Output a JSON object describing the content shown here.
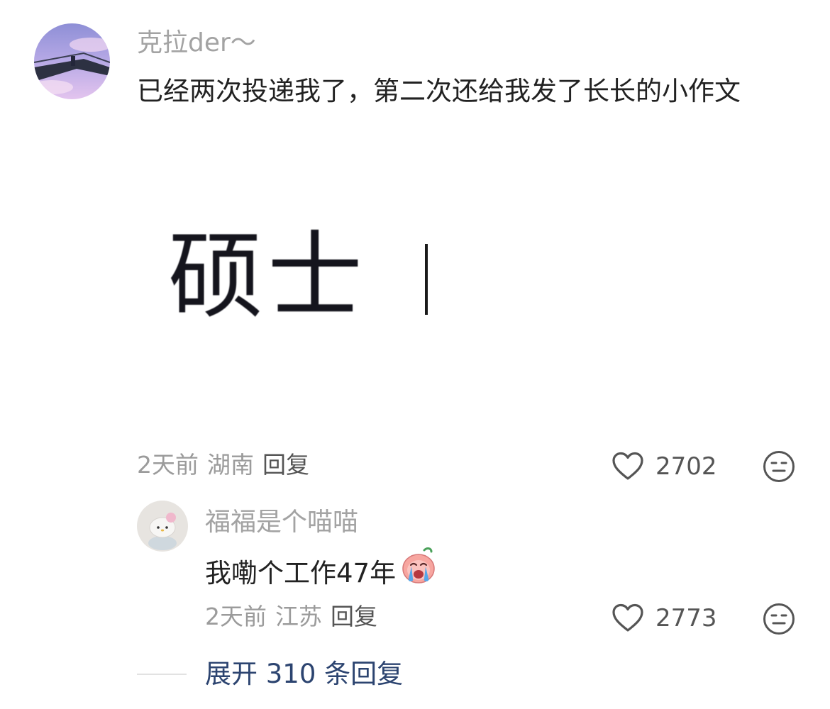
{
  "comment": {
    "username": "克拉der～",
    "text": "已经两次投递我了，第二次还给我发了长长的小作文",
    "image_text": "硕士",
    "meta": {
      "time": "2天前",
      "location": "湖南",
      "reply_label": "回复"
    },
    "likes": "2702",
    "icons": {
      "avatar": "avatar-bridge-photo",
      "like": "heart-outline-icon",
      "dislike": "unamused-face-icon"
    }
  },
  "reply": {
    "username": "福福是个喵喵",
    "text": "我嘞个工作47年",
    "emoji": "crying-face-emoji",
    "meta": {
      "time": "2天前",
      "location": "江苏",
      "reply_label": "回复"
    },
    "likes": "2773",
    "icons": {
      "avatar": "avatar-hello-kitty",
      "like": "heart-outline-icon",
      "dislike": "unamused-face-icon"
    }
  },
  "expand": {
    "label": "展开 310 条回复"
  },
  "colors": {
    "username": "#a3a3a3",
    "text": "#222222",
    "meta": "#9b9b9b",
    "expand_link": "#2c4470"
  }
}
